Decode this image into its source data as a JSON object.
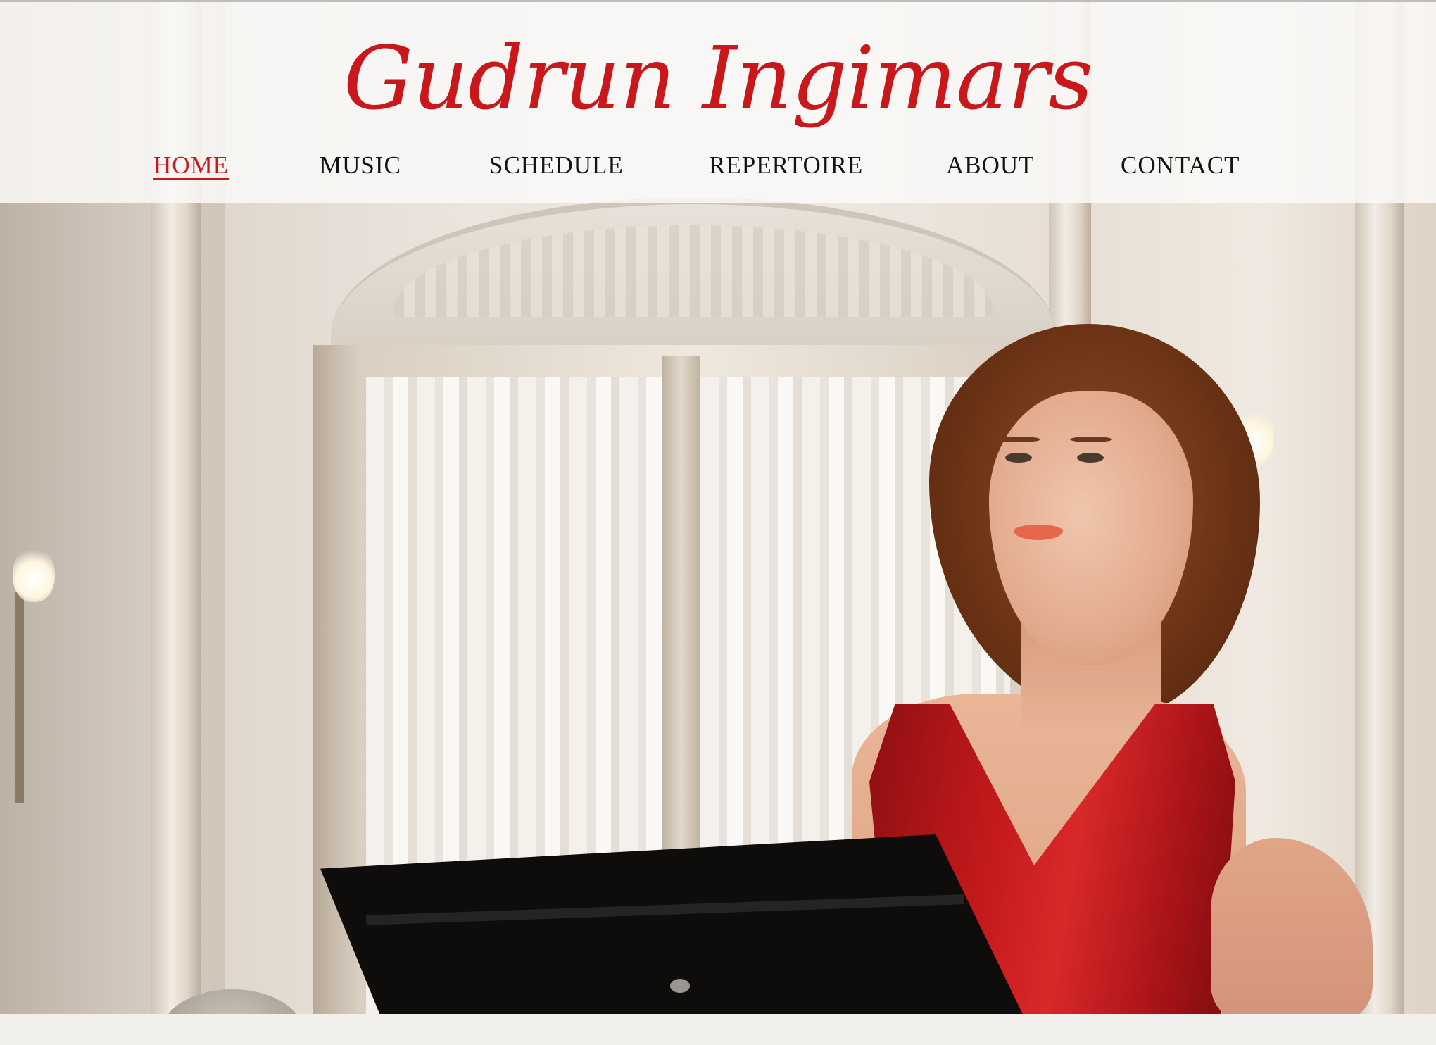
{
  "site": {
    "brand": "Gudrun Ingimars"
  },
  "nav": {
    "items": [
      {
        "label": "HOME",
        "active": true
      },
      {
        "label": "MUSIC",
        "active": false
      },
      {
        "label": "SCHEDULE",
        "active": false
      },
      {
        "label": "REPERTOIRE",
        "active": false
      },
      {
        "label": "ABOUT",
        "active": false
      },
      {
        "label": "CONTACT",
        "active": false
      }
    ]
  },
  "colors": {
    "accent": "#c8181b",
    "nav_text": "#141414",
    "header_bg": "#faf9f8"
  },
  "hero": {
    "icon": "hero-photo-singer-red-dress"
  }
}
